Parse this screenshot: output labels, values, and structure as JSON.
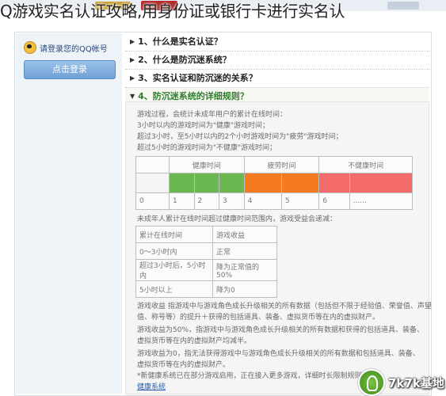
{
  "page": {
    "title": "Q游戏实名认证攻略,用身份证或银行卡进行实名认"
  },
  "sidebar": {
    "prompt": "请登录您的QQ帐号",
    "login_button": "点击登录"
  },
  "faq": [
    {
      "label": "1、什么是实名认证？"
    },
    {
      "label": "2、什么是防沉迷系统？"
    },
    {
      "label": "3、实名认证和防沉迷的关系？"
    },
    {
      "label": "4、防沉迷系统的详细规则？"
    }
  ],
  "rules": {
    "intro": [
      "游戏过程，会统计未成年用户的累计在线时间：",
      "3小时以内的游戏时间为\"健康\"游戏时间；",
      "超过3小时，至5小时以内的2个小时游戏时间为\"疲劳\"游戏时间；",
      "超过5小时的游戏时间为\"不健康\"游戏时间；"
    ],
    "bar_table": {
      "headers": [
        "健康时间",
        "疲劳时间",
        "不健康时间"
      ],
      "colors": {
        "healthy": "#6ab84f",
        "tired": "#f47b1f",
        "unhealthy": "#f36b6b"
      },
      "hours": [
        "0",
        "1",
        "2",
        "3",
        "4",
        "5",
        "6",
        "......"
      ]
    },
    "income_intro": "未成年人累计在线时间超过健康时间范围内，游戏受益会递减：",
    "income_table": {
      "headers": [
        "累计在线时间",
        "游戏收益"
      ],
      "rows": [
        [
          "0～3小时内",
          "正常"
        ],
        [
          "超过3小时后，5小时内",
          "降为正常值的50%"
        ],
        [
          "5小时以上",
          "降为0"
        ]
      ]
    },
    "notes": [
      "游戏收益 指游戏中与游戏角色成长升级相关的所有数据（包括但不限于经验值、荣誉值、声望",
      "值、称号等）的提升＋获得的包括道具、装备、虚拟货币等在内的虚拟财产。",
      "游戏收益为50%，指游戏中与游戏角色成长升级相关的所有数据和获得的包括道具、装备、",
      "虚拟货币等在内的虚拟财产均减半。",
      "游戏收益为0，指无法获得游戏中与游戏角色成长升级相关的所有数据和包括道具、装备、",
      "虚拟货币等在内的虚拟财产。",
      "*新健康系统已在部分游戏启用，正在接入更多游戏，详细时长限制规则可@",
      "健康系统"
    ]
  },
  "watermark": {
    "text": "7k7k基地"
  }
}
